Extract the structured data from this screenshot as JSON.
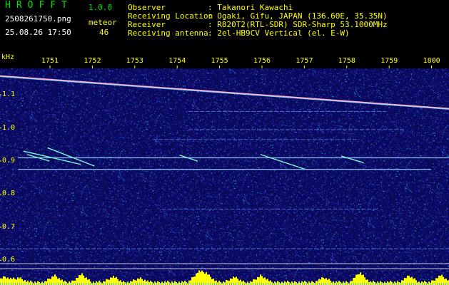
{
  "header": {
    "app_title": "HROFFT",
    "app_version": "1.0.0",
    "file_name": "2508261750.png",
    "timestamp": "25.08.26 17:50",
    "meteor_label": "meteor",
    "meteor_count": "46",
    "info": [
      {
        "key": "Observer",
        "value": ": Takanori Kawachi"
      },
      {
        "key": "Receiving Location",
        "value": ": Ogaki, Gifu, JAPAN (136.60E, 35.35N)"
      },
      {
        "key": "Receiver",
        "value": ": R820T2(RTL-SDR) SDR-Sharp 53.1000MHz"
      },
      {
        "key": "Receiving antenna",
        "value": ": 2el-HB9CV Vertical (el. E-W)"
      }
    ]
  },
  "colors": {
    "label": "#ffff00",
    "title": "#00e000",
    "background_noise": "#12126a",
    "signal_bar": "#ffff00"
  },
  "chart_data": {
    "type": "heatmap",
    "ylabel": "kHz",
    "x_ticks": [
      "1751",
      "1752",
      "1753",
      "1754",
      "1755",
      "1756",
      "1757",
      "1758",
      "1759",
      "1800"
    ],
    "y_ticks": [
      "1.1",
      "1.0",
      "0.9",
      "0.8",
      "0.7",
      "0.6"
    ],
    "x_range": [
      17.5,
      18.0
    ],
    "y_range": [
      0.59,
      1.18
    ],
    "carrier_line": {
      "x_start": 17.5,
      "y_start": 1.157,
      "x_end": 18.0,
      "y_end": 1.058
    },
    "horizontal_lines": [
      {
        "y": 0.91,
        "x_start": 17.52,
        "x_end": 18.0
      },
      {
        "y": 0.875,
        "x_start": 17.52,
        "x_end": 17.98
      },
      {
        "y": 0.995,
        "x_start": 17.71,
        "x_end": 17.95
      },
      {
        "y": 0.965,
        "x_start": 17.67,
        "x_end": 17.9
      },
      {
        "y": 1.05,
        "x_start": 17.71,
        "x_end": 17.93
      },
      {
        "y": 0.755,
        "x_start": 17.68,
        "x_end": 17.92
      },
      {
        "y": 0.635,
        "x_start": 17.5,
        "x_end": 18.0
      }
    ],
    "meteor_streaks": [
      {
        "x_start": 17.526,
        "y_start": 0.93,
        "x_end": 17.59,
        "y_end": 0.89
      },
      {
        "x_start": 17.53,
        "y_start": 0.92,
        "x_end": 17.555,
        "y_end": 0.9
      },
      {
        "x_start": 17.553,
        "y_start": 0.94,
        "x_end": 17.605,
        "y_end": 0.885
      },
      {
        "x_start": 17.79,
        "y_start": 0.92,
        "x_end": 17.84,
        "y_end": 0.875
      },
      {
        "x_start": 17.7,
        "y_start": 0.918,
        "x_end": 17.72,
        "y_end": 0.9
      },
      {
        "x_start": 17.88,
        "y_start": 0.915,
        "x_end": 17.905,
        "y_end": 0.895
      }
    ],
    "signal_strength_bursts": [
      {
        "x": 17.505,
        "h": 0.5
      },
      {
        "x": 17.52,
        "h": 0.4
      },
      {
        "x": 17.56,
        "h": 0.6
      },
      {
        "x": 17.59,
        "h": 0.7
      },
      {
        "x": 17.625,
        "h": 0.5
      },
      {
        "x": 17.655,
        "h": 0.35
      },
      {
        "x": 17.72,
        "h": 0.9
      },
      {
        "x": 17.73,
        "h": 0.7
      },
      {
        "x": 17.76,
        "h": 0.45
      },
      {
        "x": 17.79,
        "h": 0.6
      },
      {
        "x": 17.86,
        "h": 0.4
      },
      {
        "x": 17.9,
        "h": 0.85
      },
      {
        "x": 17.955,
        "h": 0.55
      },
      {
        "x": 17.99,
        "h": 0.6
      }
    ]
  }
}
